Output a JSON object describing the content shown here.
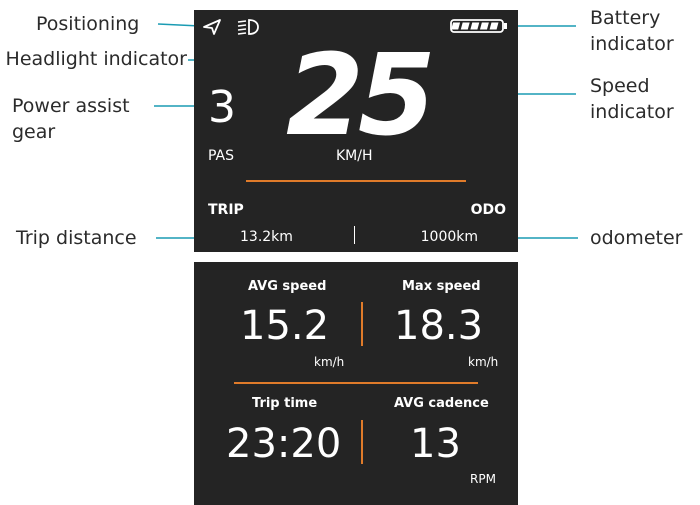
{
  "callouts": {
    "positioning": "Positioning",
    "headlight": "Headlight indicator",
    "power_assist": "Power assist\ngear",
    "trip_distance": "Trip distance",
    "battery": "Battery\nindicator",
    "speed": "Speed\nindicator",
    "odometer": "odometer"
  },
  "top_screen": {
    "pas_value": "3",
    "pas_label": "PAS",
    "speed_value": "25",
    "speed_unit": "KM/H",
    "trip_label": "TRIP",
    "odo_label": "ODO",
    "trip_value": "13.2km",
    "odo_value": "1000km",
    "battery_level": 1.0
  },
  "bottom_screen": {
    "avg_speed_label": "AVG speed",
    "avg_speed_value": "15.2",
    "avg_speed_unit": "km/h",
    "max_speed_label": "Max speed",
    "max_speed_value": "18.3",
    "max_speed_unit": "km/h",
    "trip_time_label": "Trip time",
    "trip_time_value": "23:20",
    "avg_cadence_label": "AVG cadence",
    "avg_cadence_value": "13",
    "avg_cadence_unit": "RPM"
  },
  "colors": {
    "screen_bg": "#242424",
    "accent_orange": "#e07b2a",
    "leader_line": "#1a9bb3"
  }
}
